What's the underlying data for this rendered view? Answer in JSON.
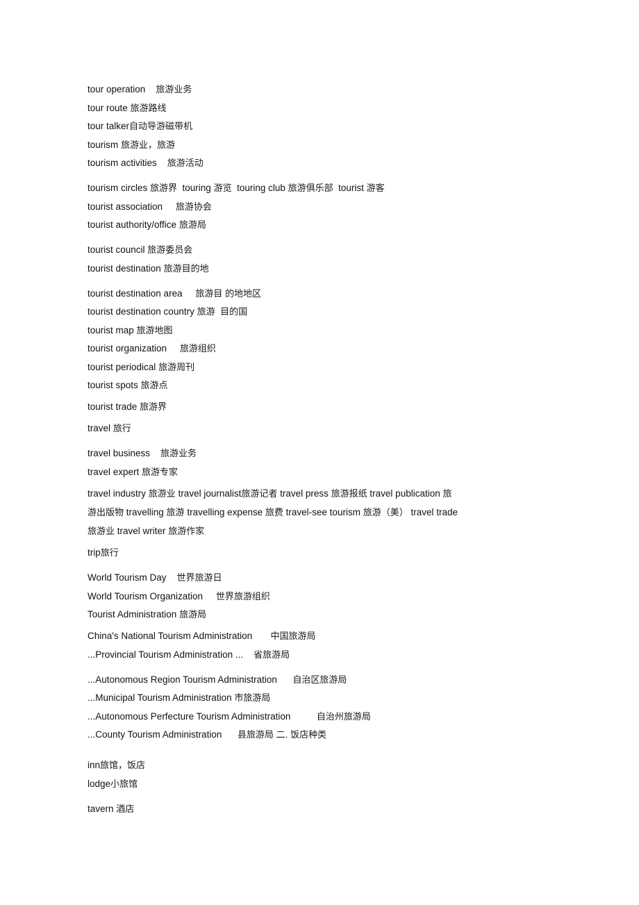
{
  "document": {
    "type": "glossary",
    "language_pair": "English-Chinese",
    "topic": "tourism terminology"
  },
  "entries": [
    {
      "id": "tour-operation",
      "text": "tour operation    旅游业务",
      "spacing": "first"
    },
    {
      "id": "tour-route",
      "text": "tour route 旅游路线",
      "spacing": "gap-sm"
    },
    {
      "id": "tour-talker",
      "text": "tour talker自动导游磁带机",
      "spacing": "gap-sm"
    },
    {
      "id": "tourism",
      "text": "tourism 旅游业，旅游",
      "spacing": "gap-sm"
    },
    {
      "id": "tourism-activities",
      "text": "tourism activities    旅游活动",
      "spacing": "gap-sm"
    },
    {
      "id": "tourism-circles",
      "text": "tourism circles 旅游界  touring 游览  touring club 旅游俱乐部  tourist 游客",
      "spacing": "gap-lg"
    },
    {
      "id": "tourist-association",
      "text": "tourist association     旅游协会",
      "spacing": "gap-sm"
    },
    {
      "id": "tourist-authority-office",
      "text": "tourist authority/office 旅游局",
      "spacing": "gap-sm"
    },
    {
      "id": "tourist-council",
      "text": "tourist council 旅游委员会",
      "spacing": "gap-lg"
    },
    {
      "id": "tourist-destination",
      "text": "tourist destination 旅游目的地",
      "spacing": "gap-sm"
    },
    {
      "id": "tourist-destination-area",
      "text": "tourist destination area     旅游目 的地地区",
      "spacing": "gap-lg"
    },
    {
      "id": "tourist-destination-country",
      "text": "tourist destination country 旅游  目的国",
      "spacing": "gap-sm"
    },
    {
      "id": "tourist-map",
      "text": "tourist map 旅游地图",
      "spacing": "gap-sm"
    },
    {
      "id": "tourist-organization",
      "text": "tourist organization     旅游组织",
      "spacing": "gap-sm"
    },
    {
      "id": "tourist-periodical",
      "text": "tourist periodical 旅游周刊",
      "spacing": "gap-sm"
    },
    {
      "id": "tourist-spots",
      "text": "tourist spots 旅游点",
      "spacing": "gap-sm"
    },
    {
      "id": "tourist-trade",
      "text": "tourist trade 旅游界",
      "spacing": "gap-md"
    },
    {
      "id": "travel",
      "text": "travel 旅行",
      "spacing": "gap-md"
    },
    {
      "id": "travel-business",
      "text": "travel business    旅游业务",
      "spacing": "gap-lg"
    },
    {
      "id": "travel-expert",
      "text": "travel expert 旅游专家",
      "spacing": "gap-sm"
    }
  ],
  "flow_block": {
    "id": "travel-terms-paragraph",
    "text": "travel industry 旅游业  travel journalist旅游记者 travel press 旅游报纸  travel publication 旅游出版物  travelling 旅游  travelling expense 旅费  travel-see tourism 旅游（美）   travel trade 旅游业  travel writer 旅游作家"
  },
  "entries_after_flow": [
    {
      "id": "trip",
      "text": "trip旅行",
      "spacing": "gap-sm"
    },
    {
      "id": "world-tourism-day",
      "text": "World Tourism Day    世界旅游日",
      "spacing": "gap-lg"
    },
    {
      "id": "world-tourism-organization",
      "text": "World Tourism Organization     世界旅游组织",
      "spacing": "gap-sm"
    },
    {
      "id": "tourist-administration",
      "text": "Tourist Administration 旅游局",
      "spacing": "gap-sm"
    },
    {
      "id": "chinas-national-tourism-administration",
      "text": "China's National Tourism Administration       中国旅游局",
      "spacing": "gap-md"
    },
    {
      "id": "provincial-tourism-administration",
      "text": "...Provincial Tourism Administration ...    省旅游局",
      "spacing": "gap-sm"
    },
    {
      "id": "autonomous-region-tourism-administration",
      "text": "...Autonomous Region Tourism Administration      自治区旅游局",
      "spacing": "gap-lg"
    },
    {
      "id": "municipal-tourism-administration",
      "text": "...Municipal Tourism Administration 市旅游局",
      "spacing": "gap-sm"
    },
    {
      "id": "autonomous-perfecture-tourism-administration",
      "text": "...Autonomous Perfecture Tourism Administration          自治州旅游局",
      "spacing": "gap-sm"
    },
    {
      "id": "county-tourism-administration",
      "text": "...County Tourism Administration      县旅游局 二. 饭店种类",
      "spacing": "gap-sm"
    },
    {
      "id": "inn",
      "text": "inn旅馆，饭店",
      "spacing": "gap-xl"
    },
    {
      "id": "lodge",
      "text": "lodge小旅馆",
      "spacing": "gap-sm"
    },
    {
      "id": "tavern",
      "text": "tavern 酒店",
      "spacing": "gap-lg"
    }
  ]
}
